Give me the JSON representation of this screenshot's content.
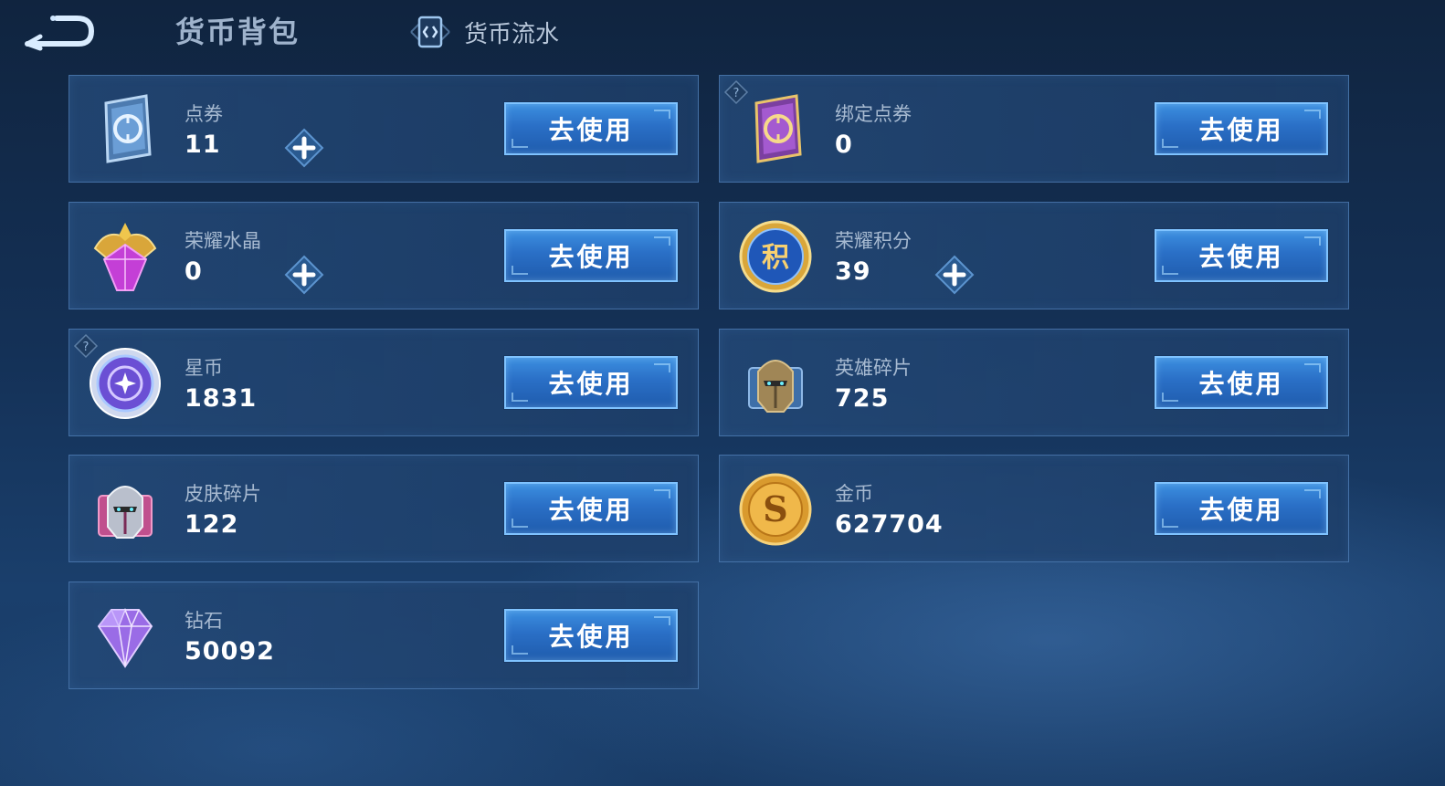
{
  "header": {
    "title": "货币背包",
    "flow_tab_label": "货币流水"
  },
  "use_label": "去使用",
  "currencies": [
    {
      "name": "点券",
      "amount": "11",
      "icon": "coupon-icon"
    },
    {
      "name": "绑定点券",
      "amount": "0",
      "icon": "bound-coupon-icon"
    },
    {
      "name": "荣耀水晶",
      "amount": "0",
      "icon": "glory-crystal-icon"
    },
    {
      "name": "荣耀积分",
      "amount": "39",
      "icon": "glory-points-icon"
    },
    {
      "name": "星币",
      "amount": "1831",
      "icon": "star-coin-icon"
    },
    {
      "name": "英雄碎片",
      "amount": "725",
      "icon": "hero-fragment-icon"
    },
    {
      "name": "皮肤碎片",
      "amount": "122",
      "icon": "skin-fragment-icon"
    },
    {
      "name": "金币",
      "amount": "627704",
      "icon": "gold-coin-icon"
    },
    {
      "name": "钻石",
      "amount": "50092",
      "icon": "diamond-icon"
    }
  ],
  "icon_glyphs": {
    "glory_points": "积",
    "gold_coin": "S"
  },
  "colors": {
    "accent": "#2a6fc6",
    "button_border": "#7fc3ff",
    "label": "#a7bad1"
  }
}
